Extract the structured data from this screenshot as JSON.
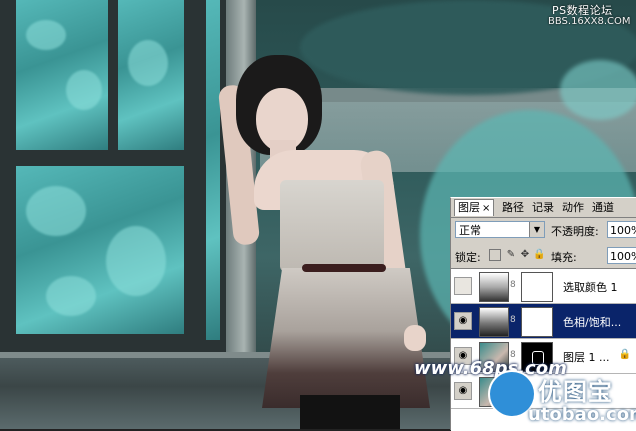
{
  "watermarks": {
    "top_line1": "PS数程论坛",
    "top_line2": "BBS.16XX8.COM",
    "site_bottom": "www.68ps.com",
    "logo_cn": "优图宝",
    "logo_url": "utobao.com"
  },
  "panel": {
    "tabs": [
      {
        "label": "图层",
        "close": "×",
        "active": true
      },
      {
        "label": "路径",
        "active": false
      },
      {
        "label": "记录",
        "active": false
      },
      {
        "label": "动作",
        "active": false
      },
      {
        "label": "通道",
        "active": false
      }
    ],
    "blend_mode": "正常",
    "opacity_label": "不透明度:",
    "opacity_value": "100%",
    "lock_label": "锁定:",
    "fill_label": "填充:",
    "fill_value": "100%",
    "layers": [
      {
        "name": "选取颜色 1",
        "visible": false,
        "selected": false,
        "icon": "adjustment-icon"
      },
      {
        "name": "色相/饱和...",
        "visible": true,
        "selected": true,
        "icon": "hue-saturation-icon"
      },
      {
        "name": "图层 1 ...",
        "visible": true,
        "selected": false,
        "icon": "photo-icon"
      }
    ]
  }
}
